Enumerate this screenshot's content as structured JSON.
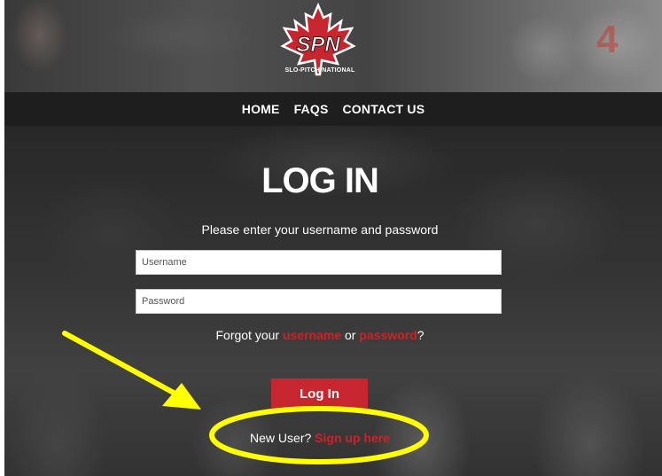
{
  "brand": {
    "logo_text": "SLO-PITCH NATIONAL",
    "logo_mark": "SPN",
    "accent_color": "#c8262e"
  },
  "header": {
    "jersey_number": "4"
  },
  "nav": {
    "items": [
      {
        "label": "HOME"
      },
      {
        "label": "FAQS"
      },
      {
        "label": "CONTACT US"
      }
    ]
  },
  "login": {
    "title": "LOG IN",
    "subtitle": "Please enter your username and password",
    "username_placeholder": "Username",
    "password_placeholder": "Password",
    "forgot_prefix": "Forgot your ",
    "forgot_username": "username",
    "forgot_or": " or ",
    "forgot_password": "password",
    "forgot_suffix": "?",
    "button_label": "Log In",
    "new_user_prefix": "New User? ",
    "signup_label": "Sign up here"
  },
  "annotation": {
    "color": "#ffff00"
  }
}
